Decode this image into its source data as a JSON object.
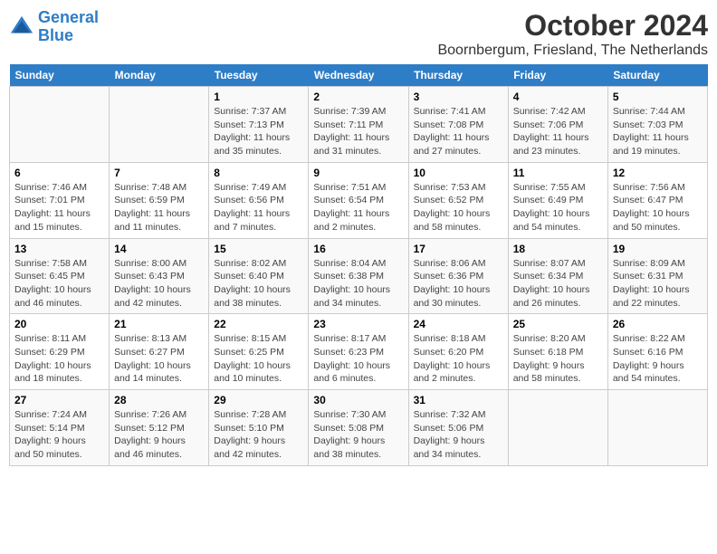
{
  "logo": {
    "line1": "General",
    "line2": "Blue"
  },
  "title": "October 2024",
  "location": "Boornbergum, Friesland, The Netherlands",
  "days_header": [
    "Sunday",
    "Monday",
    "Tuesday",
    "Wednesday",
    "Thursday",
    "Friday",
    "Saturday"
  ],
  "weeks": [
    [
      {
        "num": "",
        "info": ""
      },
      {
        "num": "",
        "info": ""
      },
      {
        "num": "1",
        "info": "Sunrise: 7:37 AM\nSunset: 7:13 PM\nDaylight: 11 hours and 35 minutes."
      },
      {
        "num": "2",
        "info": "Sunrise: 7:39 AM\nSunset: 7:11 PM\nDaylight: 11 hours and 31 minutes."
      },
      {
        "num": "3",
        "info": "Sunrise: 7:41 AM\nSunset: 7:08 PM\nDaylight: 11 hours and 27 minutes."
      },
      {
        "num": "4",
        "info": "Sunrise: 7:42 AM\nSunset: 7:06 PM\nDaylight: 11 hours and 23 minutes."
      },
      {
        "num": "5",
        "info": "Sunrise: 7:44 AM\nSunset: 7:03 PM\nDaylight: 11 hours and 19 minutes."
      }
    ],
    [
      {
        "num": "6",
        "info": "Sunrise: 7:46 AM\nSunset: 7:01 PM\nDaylight: 11 hours and 15 minutes."
      },
      {
        "num": "7",
        "info": "Sunrise: 7:48 AM\nSunset: 6:59 PM\nDaylight: 11 hours and 11 minutes."
      },
      {
        "num": "8",
        "info": "Sunrise: 7:49 AM\nSunset: 6:56 PM\nDaylight: 11 hours and 7 minutes."
      },
      {
        "num": "9",
        "info": "Sunrise: 7:51 AM\nSunset: 6:54 PM\nDaylight: 11 hours and 2 minutes."
      },
      {
        "num": "10",
        "info": "Sunrise: 7:53 AM\nSunset: 6:52 PM\nDaylight: 10 hours and 58 minutes."
      },
      {
        "num": "11",
        "info": "Sunrise: 7:55 AM\nSunset: 6:49 PM\nDaylight: 10 hours and 54 minutes."
      },
      {
        "num": "12",
        "info": "Sunrise: 7:56 AM\nSunset: 6:47 PM\nDaylight: 10 hours and 50 minutes."
      }
    ],
    [
      {
        "num": "13",
        "info": "Sunrise: 7:58 AM\nSunset: 6:45 PM\nDaylight: 10 hours and 46 minutes."
      },
      {
        "num": "14",
        "info": "Sunrise: 8:00 AM\nSunset: 6:43 PM\nDaylight: 10 hours and 42 minutes."
      },
      {
        "num": "15",
        "info": "Sunrise: 8:02 AM\nSunset: 6:40 PM\nDaylight: 10 hours and 38 minutes."
      },
      {
        "num": "16",
        "info": "Sunrise: 8:04 AM\nSunset: 6:38 PM\nDaylight: 10 hours and 34 minutes."
      },
      {
        "num": "17",
        "info": "Sunrise: 8:06 AM\nSunset: 6:36 PM\nDaylight: 10 hours and 30 minutes."
      },
      {
        "num": "18",
        "info": "Sunrise: 8:07 AM\nSunset: 6:34 PM\nDaylight: 10 hours and 26 minutes."
      },
      {
        "num": "19",
        "info": "Sunrise: 8:09 AM\nSunset: 6:31 PM\nDaylight: 10 hours and 22 minutes."
      }
    ],
    [
      {
        "num": "20",
        "info": "Sunrise: 8:11 AM\nSunset: 6:29 PM\nDaylight: 10 hours and 18 minutes."
      },
      {
        "num": "21",
        "info": "Sunrise: 8:13 AM\nSunset: 6:27 PM\nDaylight: 10 hours and 14 minutes."
      },
      {
        "num": "22",
        "info": "Sunrise: 8:15 AM\nSunset: 6:25 PM\nDaylight: 10 hours and 10 minutes."
      },
      {
        "num": "23",
        "info": "Sunrise: 8:17 AM\nSunset: 6:23 PM\nDaylight: 10 hours and 6 minutes."
      },
      {
        "num": "24",
        "info": "Sunrise: 8:18 AM\nSunset: 6:20 PM\nDaylight: 10 hours and 2 minutes."
      },
      {
        "num": "25",
        "info": "Sunrise: 8:20 AM\nSunset: 6:18 PM\nDaylight: 9 hours and 58 minutes."
      },
      {
        "num": "26",
        "info": "Sunrise: 8:22 AM\nSunset: 6:16 PM\nDaylight: 9 hours and 54 minutes."
      }
    ],
    [
      {
        "num": "27",
        "info": "Sunrise: 7:24 AM\nSunset: 5:14 PM\nDaylight: 9 hours and 50 minutes."
      },
      {
        "num": "28",
        "info": "Sunrise: 7:26 AM\nSunset: 5:12 PM\nDaylight: 9 hours and 46 minutes."
      },
      {
        "num": "29",
        "info": "Sunrise: 7:28 AM\nSunset: 5:10 PM\nDaylight: 9 hours and 42 minutes."
      },
      {
        "num": "30",
        "info": "Sunrise: 7:30 AM\nSunset: 5:08 PM\nDaylight: 9 hours and 38 minutes."
      },
      {
        "num": "31",
        "info": "Sunrise: 7:32 AM\nSunset: 5:06 PM\nDaylight: 9 hours and 34 minutes."
      },
      {
        "num": "",
        "info": ""
      },
      {
        "num": "",
        "info": ""
      }
    ]
  ]
}
